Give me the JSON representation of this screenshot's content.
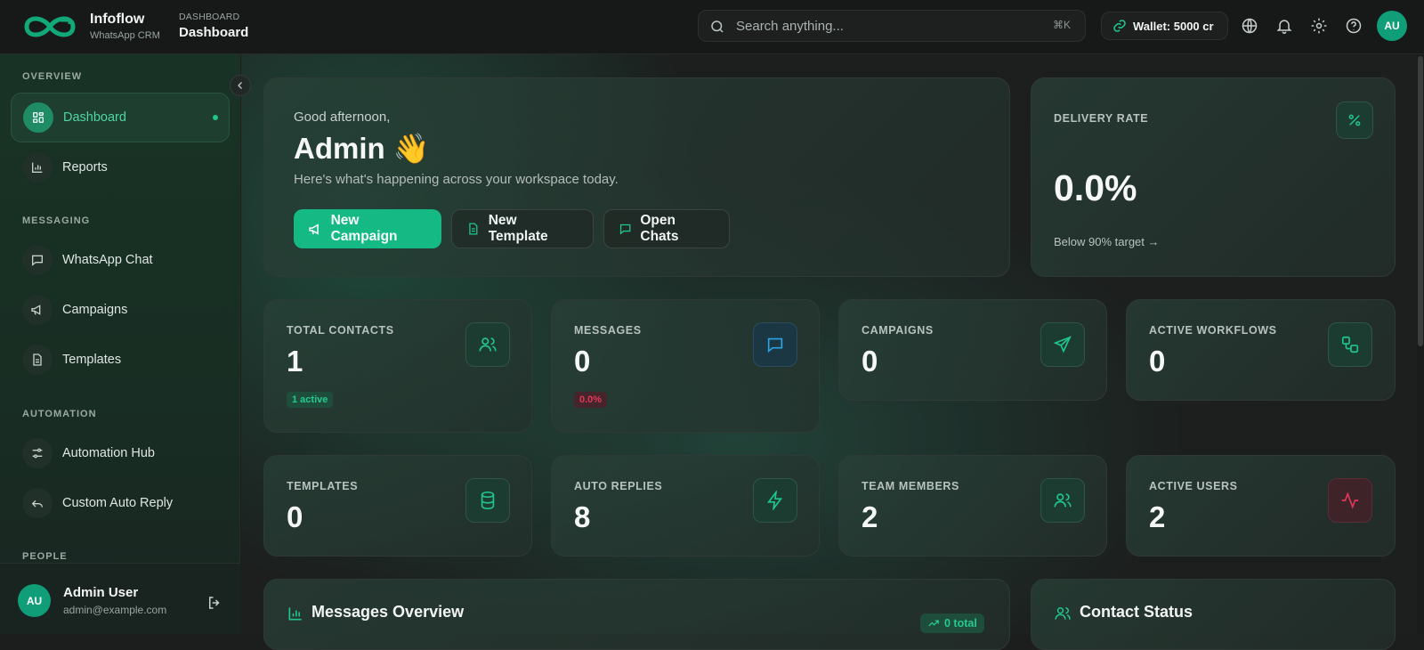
{
  "brand": {
    "name": "Infoflow",
    "subtitle": "WhatsApp CRM"
  },
  "breadcrumb": {
    "section": "DASHBOARD",
    "page": "Dashboard"
  },
  "search": {
    "placeholder": "Search anything...",
    "shortcut": "⌘K"
  },
  "wallet": {
    "label": "Wallet: 5000 cr"
  },
  "topbar_avatar": "AU",
  "sidebar": {
    "sections": {
      "overview": "OVERVIEW",
      "messaging": "MESSAGING",
      "automation": "AUTOMATION",
      "people": "PEOPLE"
    },
    "items": [
      {
        "label": "Dashboard",
        "icon": "layout-grid-icon",
        "active": true
      },
      {
        "label": "Reports",
        "icon": "bar-chart-icon"
      },
      {
        "label": "WhatsApp Chat",
        "icon": "message-square-icon"
      },
      {
        "label": "Campaigns",
        "icon": "megaphone-icon"
      },
      {
        "label": "Templates",
        "icon": "file-text-icon"
      },
      {
        "label": "Automation Hub",
        "icon": "sliders-icon"
      },
      {
        "label": "Custom Auto Reply",
        "icon": "reply-icon"
      }
    ],
    "user": {
      "initials": "AU",
      "name": "Admin User",
      "email": "admin@example.com"
    }
  },
  "hero": {
    "greeting": "Good afternoon,",
    "name": "Admin 👋",
    "description": "Here's what's happening across your workspace today.",
    "buttons": {
      "new_campaign": "New Campaign",
      "new_template": "New Template",
      "open_chats": "Open Chats"
    }
  },
  "delivery_rate": {
    "label": "DELIVERY RATE",
    "value": "0.0%",
    "note": "Below 90% target →"
  },
  "stats": [
    {
      "label": "TOTAL CONTACTS",
      "value": "1",
      "badge": "1 active",
      "icon": "users-icon"
    },
    {
      "label": "MESSAGES",
      "value": "0",
      "badge": "0.0%",
      "icon": "message-square-icon"
    },
    {
      "label": "CAMPAIGNS",
      "value": "0",
      "icon": "send-icon"
    },
    {
      "label": "ACTIVE WORKFLOWS",
      "value": "0",
      "icon": "workflow-icon"
    },
    {
      "label": "TEMPLATES",
      "value": "0",
      "icon": "database-icon"
    },
    {
      "label": "AUTO REPLIES",
      "value": "8",
      "icon": "zap-icon"
    },
    {
      "label": "TEAM MEMBERS",
      "value": "2",
      "icon": "users-icon"
    },
    {
      "label": "ACTIVE USERS",
      "value": "2",
      "icon": "activity-icon"
    }
  ],
  "messages_overview": {
    "title": "Messages Overview",
    "total_badge": "0 total"
  },
  "contact_status": {
    "title": "Contact Status"
  },
  "colors": {
    "accent": "#14b984",
    "accent_text": "#4fd7a6",
    "danger": "#e0395a",
    "blue": "#2aa4e6"
  }
}
